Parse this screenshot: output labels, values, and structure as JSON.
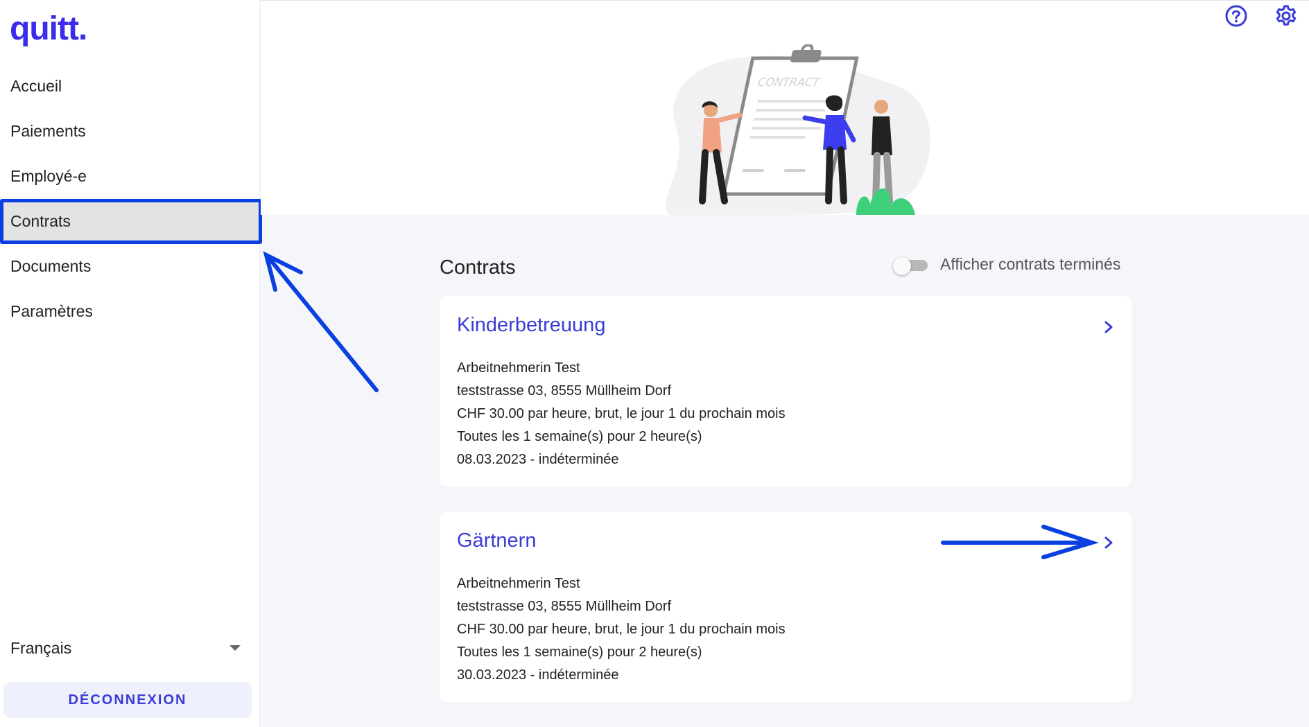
{
  "app": {
    "logo": "quitt."
  },
  "sidebar": {
    "items": [
      {
        "label": "Accueil"
      },
      {
        "label": "Paiements"
      },
      {
        "label": "Employé-e"
      },
      {
        "label": "Contrats"
      },
      {
        "label": "Documents"
      },
      {
        "label": "Paramètres"
      }
    ],
    "active_index": 3,
    "language": "Français",
    "logout_label": "DÉCONNEXION"
  },
  "header": {
    "icons": [
      "help-icon",
      "gear-icon"
    ],
    "illustration_text": "CONTRACT"
  },
  "main": {
    "title": "Contrats",
    "toggle": {
      "label": "Afficher contrats terminés",
      "checked": false
    },
    "contracts": [
      {
        "title": "Kinderbetreuung",
        "employee": "Arbeitnehmerin Test",
        "address": "teststrasse 03, 8555 Müllheim Dorf",
        "pay": "CHF 30.00 par heure, brut, le jour 1 du prochain mois",
        "schedule": "Toutes les 1 semaine(s) pour 2 heure(s)",
        "period": "08.03.2023 - indéterminée"
      },
      {
        "title": "Gärtnern",
        "employee": "Arbeitnehmerin Test",
        "address": "teststrasse 03, 8555 Müllheim Dorf",
        "pay": "CHF 30.00 par heure, brut, le jour 1 du prochain mois",
        "schedule": "Toutes les 1 semaine(s) pour 2 heure(s)",
        "period": "30.03.2023 - indéterminée"
      }
    ]
  },
  "colors": {
    "brand": "#3b2bea",
    "link": "#3b3bd6",
    "annotation": "#0a3fe0",
    "plant": "#3ecf7a",
    "accent_person": "#3d3df0"
  }
}
